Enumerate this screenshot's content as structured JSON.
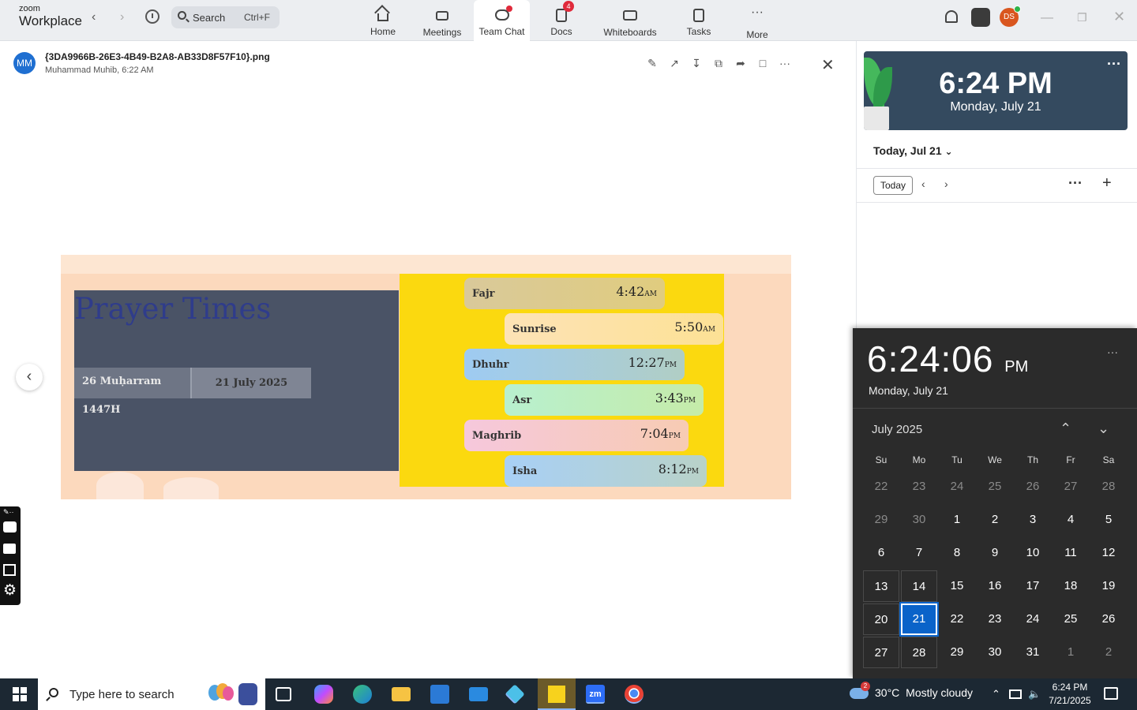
{
  "app": {
    "brand_small": "zoom",
    "brand_large": "Workplace"
  },
  "search": {
    "label": "Search",
    "shortcut": "Ctrl+F"
  },
  "nav_tabs": [
    {
      "label": "Home",
      "icon": "home-icon"
    },
    {
      "label": "Meetings",
      "icon": "video-camera-icon"
    },
    {
      "label": "Team Chat",
      "icon": "chat-icon",
      "active": true
    },
    {
      "label": "Docs",
      "icon": "docs-icon",
      "badge": "4"
    },
    {
      "label": "Whiteboards",
      "icon": "whiteboard-icon"
    },
    {
      "label": "Tasks",
      "icon": "tasks-icon"
    },
    {
      "label": "More",
      "icon": "more-dots-icon"
    }
  ],
  "user_avatar_initials": "DS",
  "viewer": {
    "avatar_initials": "MM",
    "filename": "{3DA9966B-26E3-4B49-B2A8-AB33D8F57F10}.png",
    "meta": "Muhammad Muhib, 6:22 AM"
  },
  "prayer_image": {
    "title": "Prayer Times",
    "hijri_date": "26 Muḥarram 1447H",
    "greg_date": "21 July 2025",
    "prayers": [
      {
        "name": "Fajr",
        "time": "4:42",
        "ampm": "AM",
        "color": "#d9c99a"
      },
      {
        "name": "Sunrise",
        "time": "5:50",
        "ampm": "AM",
        "color": "#fde3b6"
      },
      {
        "name": "Dhuhr",
        "time": "12:27",
        "ampm": "PM",
        "color": "#9ecbf2"
      },
      {
        "name": "Asr",
        "time": "3:43",
        "ampm": "PM",
        "color": "#b8f0cf"
      },
      {
        "name": "Maghrib",
        "time": "7:04",
        "ampm": "PM",
        "color": "#f6c8dc"
      },
      {
        "name": "Isha",
        "time": "8:12",
        "ampm": "PM",
        "color": "#a8d0f6"
      }
    ]
  },
  "right_panel": {
    "clock_time": "6:24 PM",
    "clock_date": "Monday, July 21",
    "today_header": "Today, Jul 21",
    "today_button": "Today"
  },
  "calendar_flyout": {
    "time_main": "6:24:06",
    "time_ampm": "PM",
    "date": "Monday, July 21",
    "month_label": "July 2025",
    "dow": [
      "Su",
      "Mo",
      "Tu",
      "We",
      "Th",
      "Fr",
      "Sa"
    ],
    "weeks": [
      [
        "22",
        "23",
        "24",
        "25",
        "26",
        "27",
        "28"
      ],
      [
        "29",
        "30",
        "1",
        "2",
        "3",
        "4",
        "5"
      ],
      [
        "6",
        "7",
        "8",
        "9",
        "10",
        "11",
        "12"
      ],
      [
        "13",
        "14",
        "15",
        "16",
        "17",
        "18",
        "19"
      ],
      [
        "20",
        "21",
        "22",
        "23",
        "24",
        "25",
        "26"
      ],
      [
        "27",
        "28",
        "29",
        "30",
        "31",
        "1",
        "2"
      ]
    ],
    "selected_day": "21"
  },
  "taskbar": {
    "search_placeholder": "Type here to search",
    "weather_temp": "30°C",
    "weather_text": "Mostly cloudy",
    "weather_badge": "2",
    "clock_time": "6:24 PM",
    "clock_date": "7/21/2025"
  }
}
